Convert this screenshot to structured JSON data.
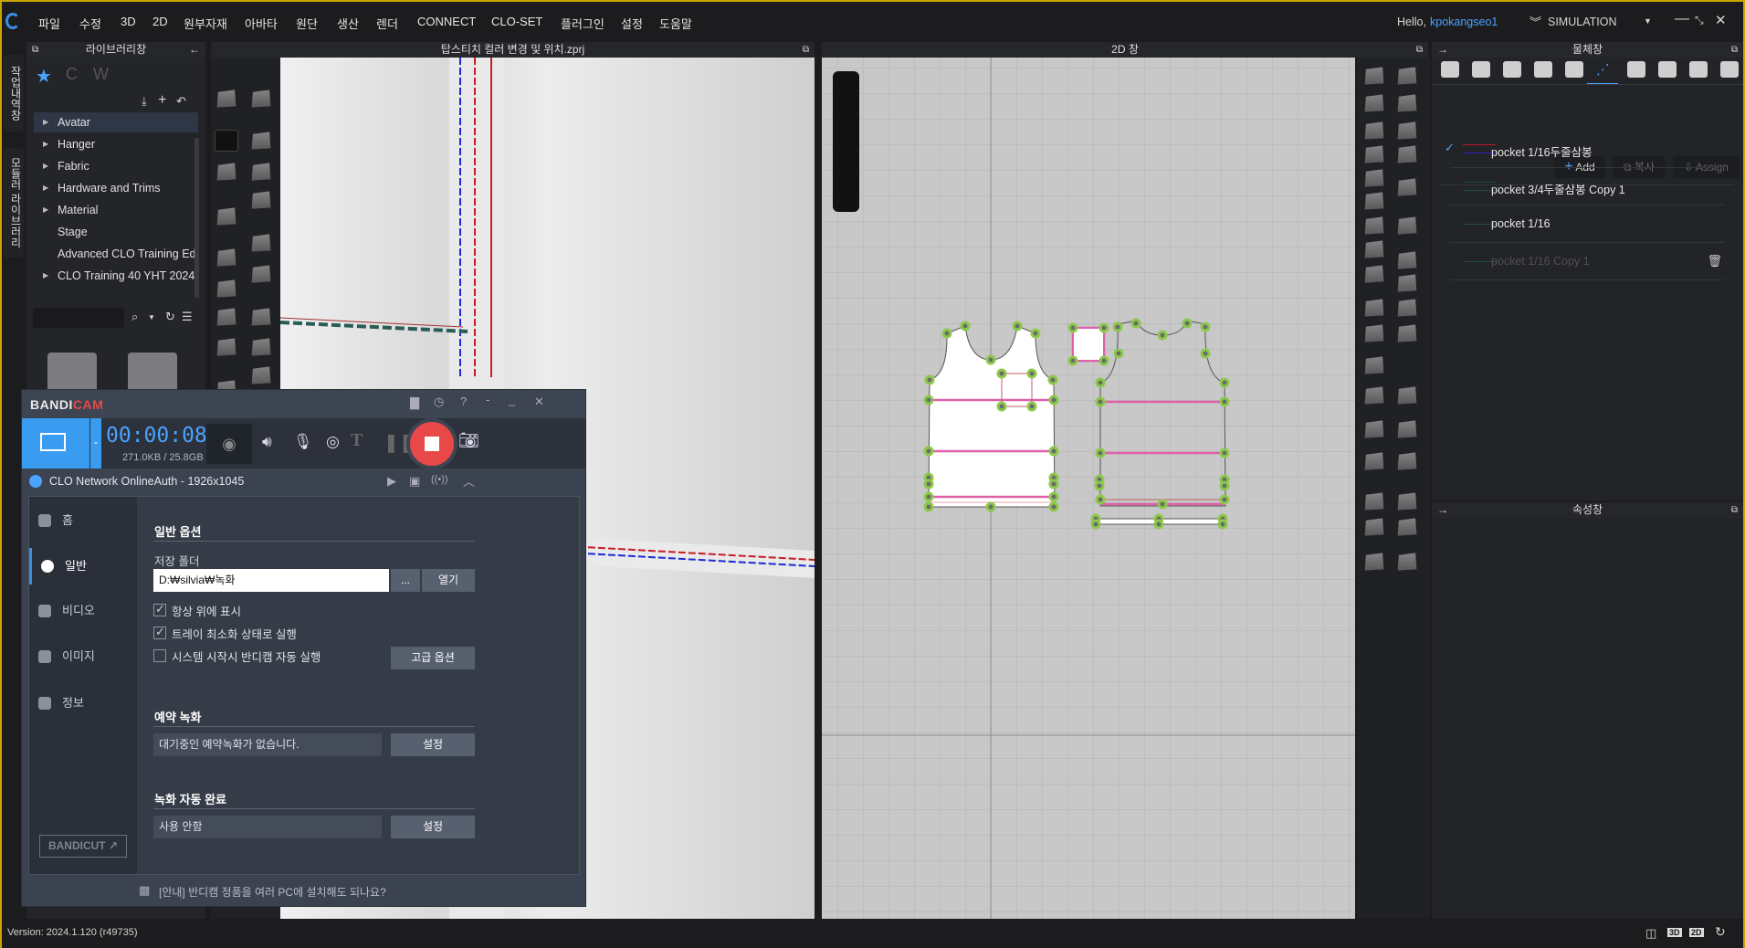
{
  "menubar": {
    "items": [
      "파일",
      "수정",
      "3D",
      "2D",
      "원부자재",
      "아바타",
      "원단",
      "생산",
      "렌더",
      "CONNECT",
      "CLO-SET",
      "플러그인",
      "설정",
      "도움말"
    ],
    "greeting": "Hello, ",
    "username": "kpokangseo1",
    "mode": "SIMULATION",
    "accent": "#4aa3ff"
  },
  "side_tabs": [
    "작업내역창",
    "모듈러 라이브러리"
  ],
  "library": {
    "title": "라이브러리창",
    "tree": [
      {
        "label": "Avatar",
        "expandable": true,
        "selected": true
      },
      {
        "label": "Hanger",
        "expandable": true
      },
      {
        "label": "Fabric",
        "expandable": true
      },
      {
        "label": "Hardware and Trims",
        "expandable": true
      },
      {
        "label": "Material",
        "expandable": true
      },
      {
        "label": "Stage",
        "expandable": false
      },
      {
        "label": "Advanced CLO Training Ed",
        "expandable": false
      },
      {
        "label": "CLO Training 40 YHT 2024",
        "expandable": true
      }
    ],
    "search_value": ""
  },
  "view3d": {
    "title": "탑스티치 컬러 변경 및 위치.zprj"
  },
  "view2d": {
    "title": "2D 창"
  },
  "object_panel": {
    "title": "물체창",
    "tabs": [
      "fabric-icon",
      "graphic-icon",
      "texture-icon",
      "button-icon",
      "buttonhole-icon",
      "topstitch-icon",
      "puckering-icon",
      "trim-icon",
      "zipper-icon",
      "measure-icon"
    ],
    "active_tab": 5,
    "add_label": "Add",
    "copy_label": "복사",
    "assign_label": "Assign",
    "items": [
      {
        "label": "pocket 1/16두줄삼봉",
        "checked": true,
        "colors": [
          "#c0162c",
          "#2a1ec0"
        ],
        "dim": false
      },
      {
        "label": "pocket 3/4두줄삼봉 Copy 1",
        "checked": false,
        "colors": [
          "#1f4a4c",
          "#1f4a4c"
        ],
        "dim": false
      },
      {
        "label": "pocket 1/16",
        "checked": false,
        "colors": [
          "#1f4a4c"
        ],
        "dim": false
      },
      {
        "label": "pocket 1/16 Copy 1",
        "checked": false,
        "colors": [
          "#1f4a4c"
        ],
        "dim": true
      }
    ]
  },
  "property_panel": {
    "title": "속성창"
  },
  "status": {
    "version": "Version: 2024.1.120 (r49735)",
    "view_buttons": [
      "3D",
      "2D"
    ]
  },
  "bandicam": {
    "logo_a": "BANDI",
    "logo_b": "CAM",
    "timer": "00:00:08",
    "size": "271.0KB / 25.8GB",
    "target": "CLO Network OnlineAuth - 1926x1045",
    "nav": [
      "홈",
      "일반",
      "비디오",
      "이미지",
      "정보"
    ],
    "active_nav": 1,
    "general": {
      "heading": "일반 옵션",
      "folder_label": "저장 폴더",
      "folder_value": "D:₩silvia₩녹화",
      "browse": "...",
      "open": "열기",
      "options": [
        {
          "label": "항상 위에 표시",
          "checked": true
        },
        {
          "label": "트레이 최소화 상태로 실행",
          "checked": true
        },
        {
          "label": "시스템 시작시 반디캠 자동 실행",
          "checked": false
        }
      ],
      "advanced": "고급 옵션"
    },
    "schedule": {
      "heading": "예약 녹화",
      "value": "대기중인 예약녹화가 없습니다.",
      "button": "설정"
    },
    "autocomplete": {
      "heading": "녹화 자동 완료",
      "value": "사용 안함",
      "button": "설정"
    },
    "bandicut": "BANDICUT ↗",
    "notice": "[안내] 반디캠 정품을 여러 PC에 설치해도 되나요?",
    "record_color": "#e84848"
  }
}
